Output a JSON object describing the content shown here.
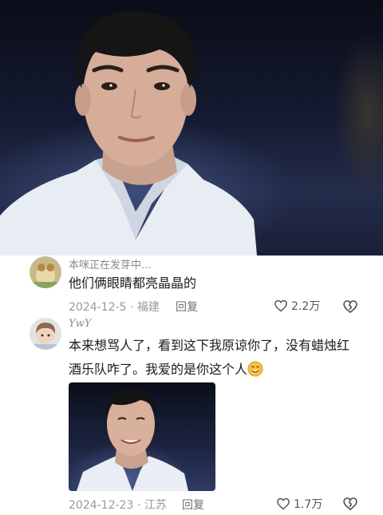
{
  "comments": [
    {
      "username": "本咪正在发芽中...",
      "text": "他们俩眼睛都亮晶晶的",
      "date": "2024-12-5",
      "location": "福建",
      "reply_label": "回复",
      "likes": "2.2万"
    },
    {
      "username": "YwY",
      "text_line1": "本来想骂人了，看到这下我原谅你了，没有蜡烛红",
      "text_line2": "酒乐队咋了。我爱的是你这个人",
      "date": "2024-12-23",
      "location": "江苏",
      "reply_label": "回复",
      "likes": "1.7万"
    }
  ],
  "icons": {
    "like": "heart-outline-icon",
    "dislike": "broken-heart-icon",
    "emoji": "smiling-face-icon"
  },
  "colors": {
    "text": "#1b1b1b",
    "meta": "#9a9a9a"
  }
}
